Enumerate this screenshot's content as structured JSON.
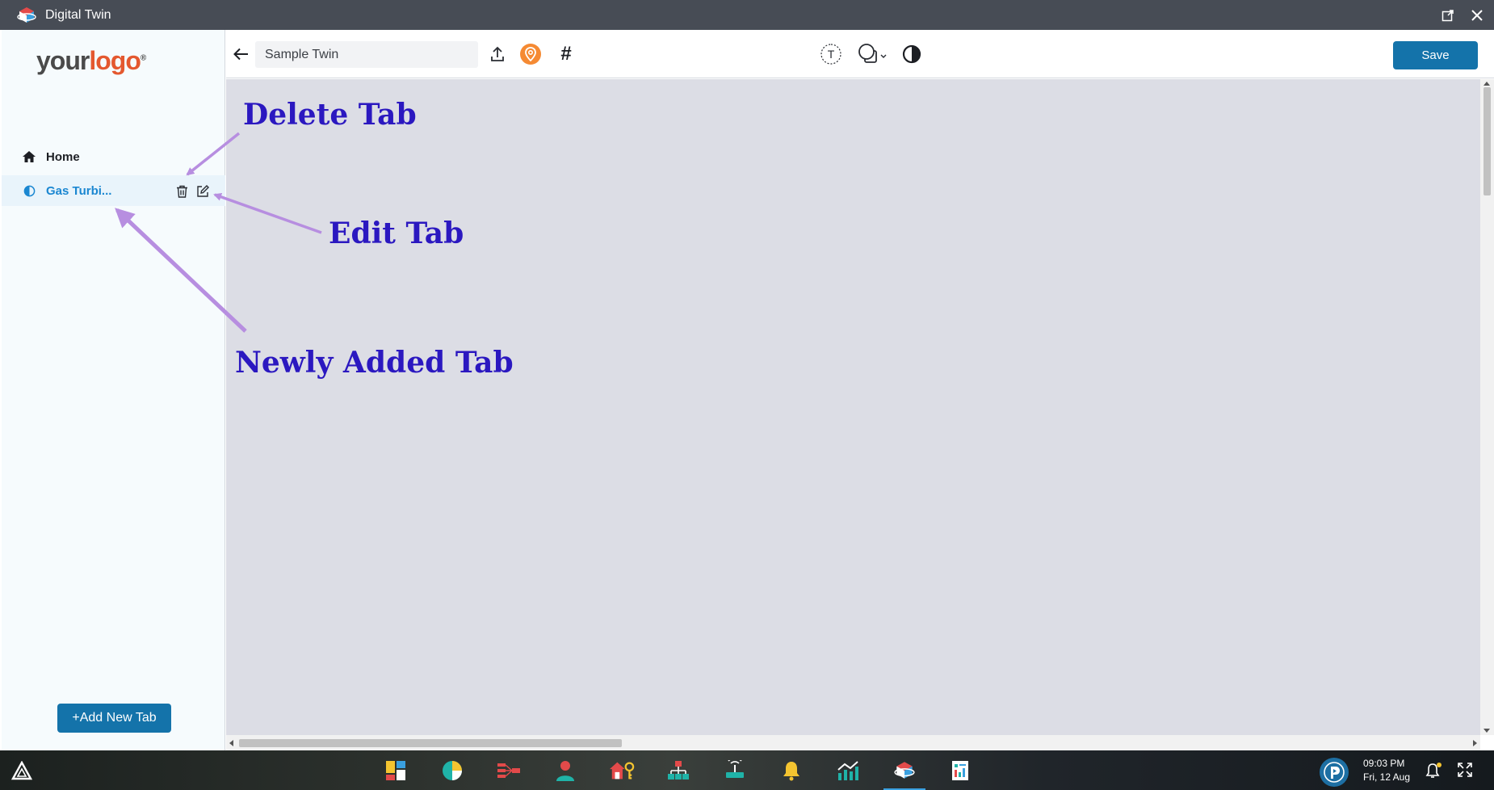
{
  "window": {
    "title": "Digital Twin"
  },
  "sidebar": {
    "logo": {
      "your": "your",
      "logo": "logo",
      "mark": "®"
    },
    "items": [
      {
        "label": "Home",
        "icon": "home-icon"
      },
      {
        "label": "Gas Turbi...",
        "icon": "half-circle-icon",
        "active": true
      }
    ],
    "add_tab_label": "+Add New Tab"
  },
  "toolbar": {
    "name_value": "Sample Twin",
    "save_label": "Save",
    "hash_label": "#",
    "text_tool_label": "T"
  },
  "annotations": {
    "delete": "Delete Tab",
    "edit": "Edit Tab",
    "new": "Newly Added Tab"
  },
  "taskbar": {
    "time": "09:03 PM",
    "date": "Fri, 12 Aug"
  },
  "colors": {
    "accent": "#1473aa",
    "active_tab_text": "#1b87d1",
    "annotation_text": "#2b18c0",
    "annotation_arrow": "#b78ee0",
    "canvas": "#dcdde5",
    "location": "#f58a33"
  }
}
